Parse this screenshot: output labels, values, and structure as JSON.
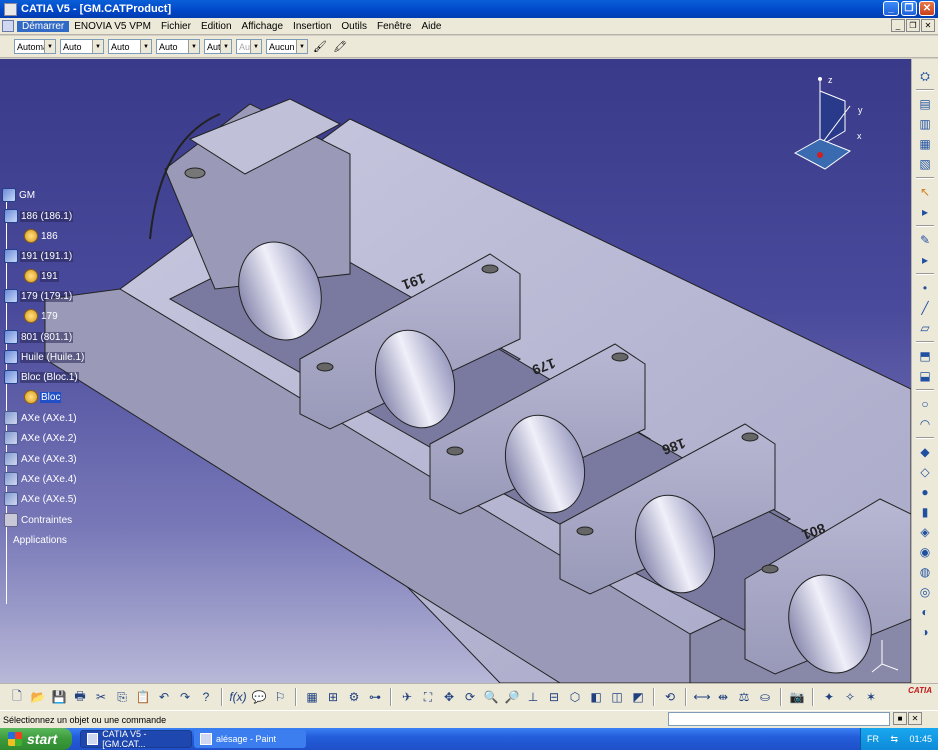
{
  "window": {
    "title": "CATIA V5 - [GM.CATProduct]"
  },
  "menubar": {
    "items": [
      "Démarrer",
      "ENOVIA V5 VPM",
      "Fichier",
      "Edition",
      "Affichage",
      "Insertion",
      "Outils",
      "Fenêtre",
      "Aide"
    ]
  },
  "toolbar": {
    "combos": [
      "Automa",
      "Auto",
      "Auto",
      "Auto",
      "Aut",
      "Aut",
      "Aucun"
    ]
  },
  "tree": {
    "root": "GM",
    "nodes": [
      {
        "label": "186 (186.1)"
      },
      {
        "label": "186"
      },
      {
        "label": "191 (191.1)"
      },
      {
        "label": "191"
      },
      {
        "label": "179 (179.1)"
      },
      {
        "label": "179"
      },
      {
        "label": "801 (801.1)"
      },
      {
        "label": "Huile (Huile.1)"
      },
      {
        "label": "Bloc (Bloc.1)"
      },
      {
        "label": "Bloc"
      },
      {
        "label": "AXe (AXe.1)"
      },
      {
        "label": "AXe (AXe.2)"
      },
      {
        "label": "AXe (AXe.3)"
      },
      {
        "label": "AXe (AXe.4)"
      },
      {
        "label": "AXe (AXe.5)"
      },
      {
        "label": "Contraintes"
      },
      {
        "label": "Applications"
      }
    ]
  },
  "model": {
    "engravings": [
      "191",
      "179",
      "186",
      "801"
    ]
  },
  "compass": {
    "x": "x",
    "y": "y",
    "z": "z"
  },
  "status": {
    "text": "Sélectionnez un objet ou une commande"
  },
  "taskbar": {
    "start": "start",
    "tasks": [
      "CATIA V5 - [GM.CAT...",
      "alésage - Paint"
    ],
    "lang": "FR",
    "time": "01:45"
  },
  "brand": {
    "logo": "CATIA"
  }
}
